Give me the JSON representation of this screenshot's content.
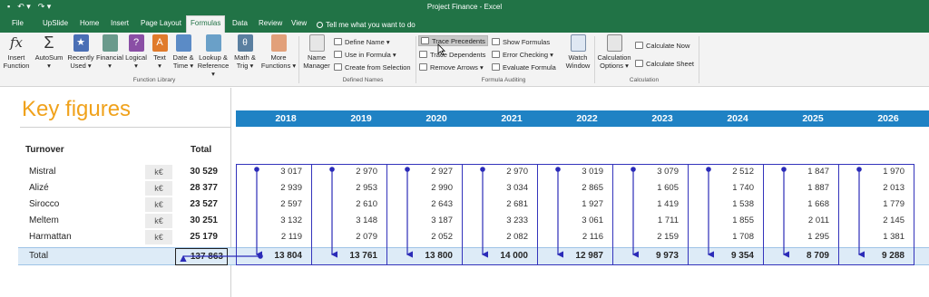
{
  "window": {
    "title": "Project Finance  -  Excel"
  },
  "tabs": [
    "File",
    "UpSlide",
    "Home",
    "Insert",
    "Page Layout",
    "Formulas",
    "Data",
    "Review",
    "View"
  ],
  "active_tab": "Formulas",
  "tell_me": "Tell me what you want to do",
  "ribbon": {
    "function_library": {
      "label": "Function Library",
      "buttons": [
        {
          "l1": "Insert",
          "l2": "Function",
          "icon": "fx-icon"
        },
        {
          "l1": "AutoSum",
          "l2": "▾",
          "icon": "sigma-icon"
        },
        {
          "l1": "Recently",
          "l2": "Used ▾",
          "icon": "star-book-icon"
        },
        {
          "l1": "Financial",
          "l2": "▾",
          "icon": "financial-book-icon"
        },
        {
          "l1": "Logical",
          "l2": "▾",
          "icon": "logical-book-icon"
        },
        {
          "l1": "Text",
          "l2": "▾",
          "icon": "text-book-icon"
        },
        {
          "l1": "Date &",
          "l2": "Time ▾",
          "icon": "date-book-icon"
        },
        {
          "l1": "Lookup &",
          "l2": "Reference ▾",
          "icon": "lookup-book-icon"
        },
        {
          "l1": "Math &",
          "l2": "Trig ▾",
          "icon": "math-book-icon"
        },
        {
          "l1": "More",
          "l2": "Functions ▾",
          "icon": "more-functions-icon"
        }
      ]
    },
    "defined_names": {
      "label": "Defined Names",
      "name_manager": {
        "l1": "Name",
        "l2": "Manager"
      },
      "items": [
        "Define Name ▾",
        "Use in Formula ▾",
        "Create from Selection"
      ]
    },
    "formula_auditing": {
      "label": "Formula Auditing",
      "items": [
        "Trace Precedents",
        "Trace Dependents",
        "Remove Arrows ▾",
        "Show Formulas",
        "Error Checking ▾",
        "Evaluate Formula"
      ],
      "watch": {
        "l1": "Watch",
        "l2": "Window"
      }
    },
    "calculation": {
      "label": "Calculation",
      "options": {
        "l1": "Calculation",
        "l2": "Options ▾"
      },
      "items": [
        "Calculate Now",
        "Calculate Sheet"
      ]
    }
  },
  "sheet": {
    "title": "Key figures",
    "years": [
      "2018",
      "2019",
      "2020",
      "2021",
      "2022",
      "2023",
      "2024",
      "2025",
      "2026"
    ],
    "row_header": "Turnover",
    "total_header": "Total",
    "rows": [
      {
        "name": "Mistral",
        "unit": "k€",
        "total": "30 529",
        "values": [
          "3 017",
          "2 970",
          "2 927",
          "2 970",
          "3 019",
          "3 079",
          "2 512",
          "1 847",
          "1 970"
        ]
      },
      {
        "name": "Alizé",
        "unit": "k€",
        "total": "28 377",
        "values": [
          "2 939",
          "2 953",
          "2 990",
          "3 034",
          "2 865",
          "1 605",
          "1 740",
          "1 887",
          "2 013"
        ]
      },
      {
        "name": "Sirocco",
        "unit": "k€",
        "total": "23 527",
        "values": [
          "2 597",
          "2 610",
          "2 643",
          "2 681",
          "1 927",
          "1 419",
          "1 538",
          "1 668",
          "1 779"
        ]
      },
      {
        "name": "Meltem",
        "unit": "k€",
        "total": "30 251",
        "values": [
          "3 132",
          "3 148",
          "3 187",
          "3 233",
          "3 061",
          "1 711",
          "1 855",
          "2 011",
          "2 145"
        ]
      },
      {
        "name": "Harmattan",
        "unit": "k€",
        "total": "25 179",
        "values": [
          "2 119",
          "2 079",
          "2 052",
          "2 082",
          "2 116",
          "2 159",
          "1 708",
          "1 295",
          "1 381"
        ]
      }
    ],
    "total_row": {
      "label": "Total",
      "total": "137 863",
      "values": [
        "13 804",
        "13 761",
        "13 800",
        "14 000",
        "12 987",
        "9 973",
        "9 354",
        "8 709",
        "9 288"
      ]
    }
  },
  "colors": {
    "excel_green": "#217346",
    "year_header": "#1f82c4",
    "title_orange": "#f0a21c",
    "total_fill": "#ddebf7",
    "trace_arrow": "#2b2bb8"
  }
}
